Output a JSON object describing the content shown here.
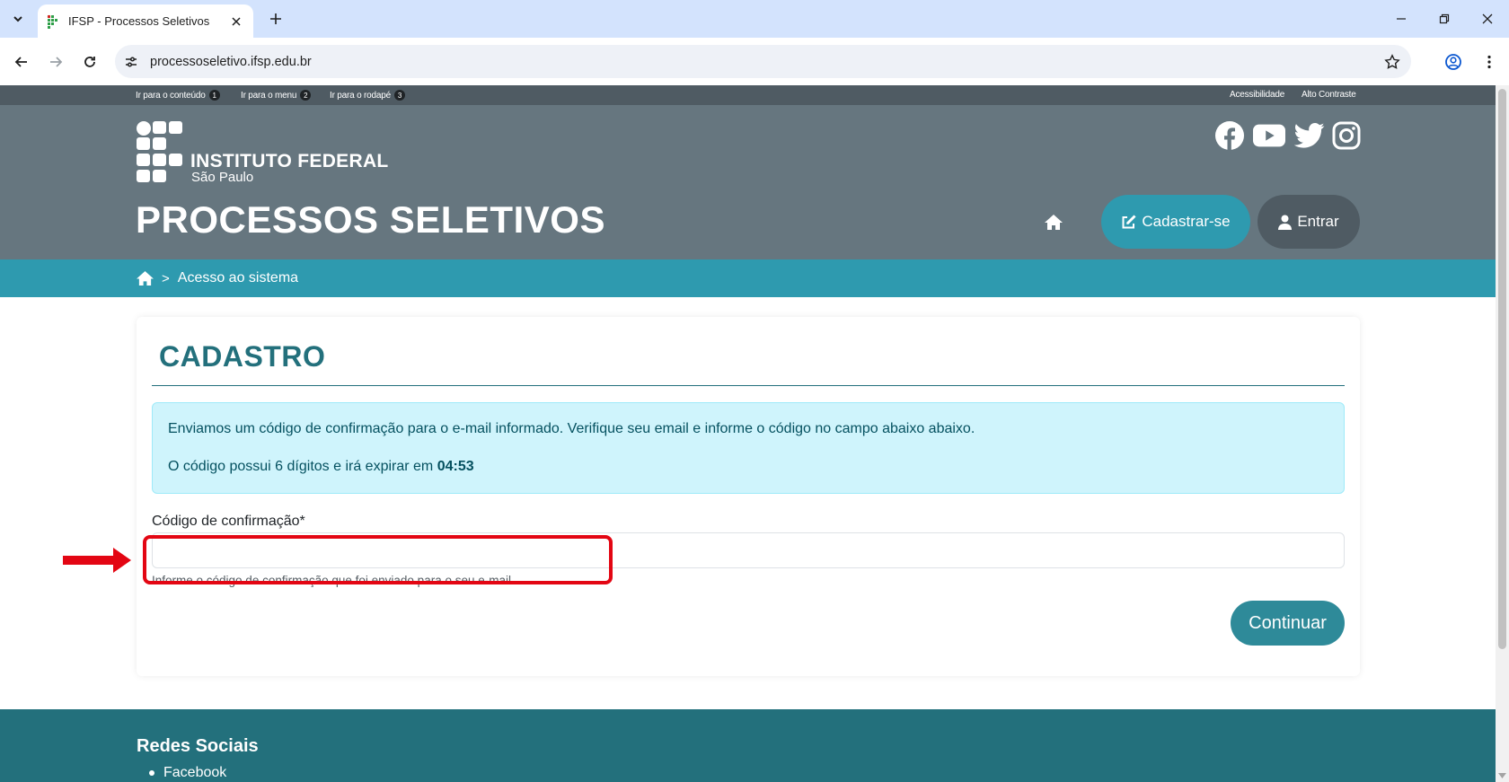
{
  "browser": {
    "tab_title": "IFSP - Processos Seletivos",
    "url": "processoseletivo.ifsp.edu.br"
  },
  "skip_links": [
    {
      "label": "Ir para o conteúdo",
      "num": "1"
    },
    {
      "label": "Ir para o menu",
      "num": "2"
    },
    {
      "label": "Ir para o rodapé",
      "num": "3"
    }
  ],
  "accessibility": {
    "acessibilidade": "Acessibilidade",
    "alto_contraste": "Alto Contraste"
  },
  "header": {
    "logo_title": "INSTITUTO FEDERAL",
    "logo_subtitle": "São Paulo",
    "site_title": "PROCESSOS SELETIVOS",
    "cadastrar_label": "Cadastrar-se",
    "entrar_label": "Entrar"
  },
  "breadcrumb": {
    "separator": ">",
    "current": "Acesso ao sistema"
  },
  "form": {
    "title": "CADASTRO",
    "alert_line1": "Enviamos um código de confirmação para o e-mail informado. Verifique seu email e informe o código no campo abaixo abaixo.",
    "alert_line2_prefix": "O código possui 6 dígitos e irá expirar em",
    "alert_timer": "04:53",
    "field_label": "Código de confirmação*",
    "field_value": "",
    "field_help": "Informe o código de confirmação que foi enviado para o seu e-mail",
    "submit_label": "Continuar"
  },
  "footer": {
    "title": "Redes Sociais",
    "items": [
      "Facebook"
    ]
  },
  "colors": {
    "header_bg": "#66767f",
    "skipbar_bg": "#4f5b63",
    "accent_teal": "#2e9aaf",
    "dark_teal": "#23707c",
    "alert_bg": "#cff4fc",
    "annotation_red": "#e30613"
  },
  "icons": {
    "social": [
      "facebook-icon",
      "youtube-icon",
      "twitter-icon",
      "instagram-icon"
    ],
    "nav": [
      "home-icon",
      "edit-icon",
      "user-icon"
    ]
  }
}
